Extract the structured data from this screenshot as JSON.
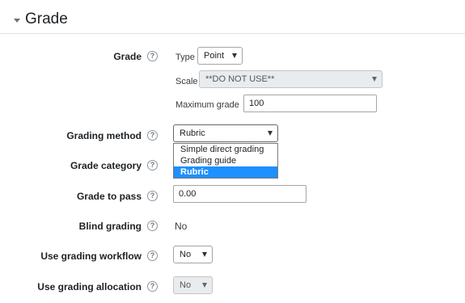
{
  "section": {
    "title": "Grade"
  },
  "grade": {
    "label": "Grade",
    "type_label": "Type",
    "type_value": "Point",
    "scale_label": "Scale",
    "scale_value": "**DO NOT USE**",
    "max_grade_label": "Maximum grade",
    "max_grade_value": "100"
  },
  "grading_method": {
    "label": "Grading method",
    "value": "Rubric",
    "options": [
      "Simple direct grading",
      "Grading guide",
      "Rubric"
    ],
    "selected_option": "Rubric"
  },
  "grade_category": {
    "label": "Grade category"
  },
  "grade_to_pass": {
    "label": "Grade to pass",
    "value": "0.00"
  },
  "blind_grading": {
    "label": "Blind grading",
    "value": "No"
  },
  "grading_workflow": {
    "label": "Use grading workflow",
    "value": "No"
  },
  "grading_allocation": {
    "label": "Use grading allocation",
    "value": "No"
  },
  "help_glyph": "?",
  "colors": {
    "selected_option_bg": "#1e90ff",
    "title": "#1d2125"
  }
}
